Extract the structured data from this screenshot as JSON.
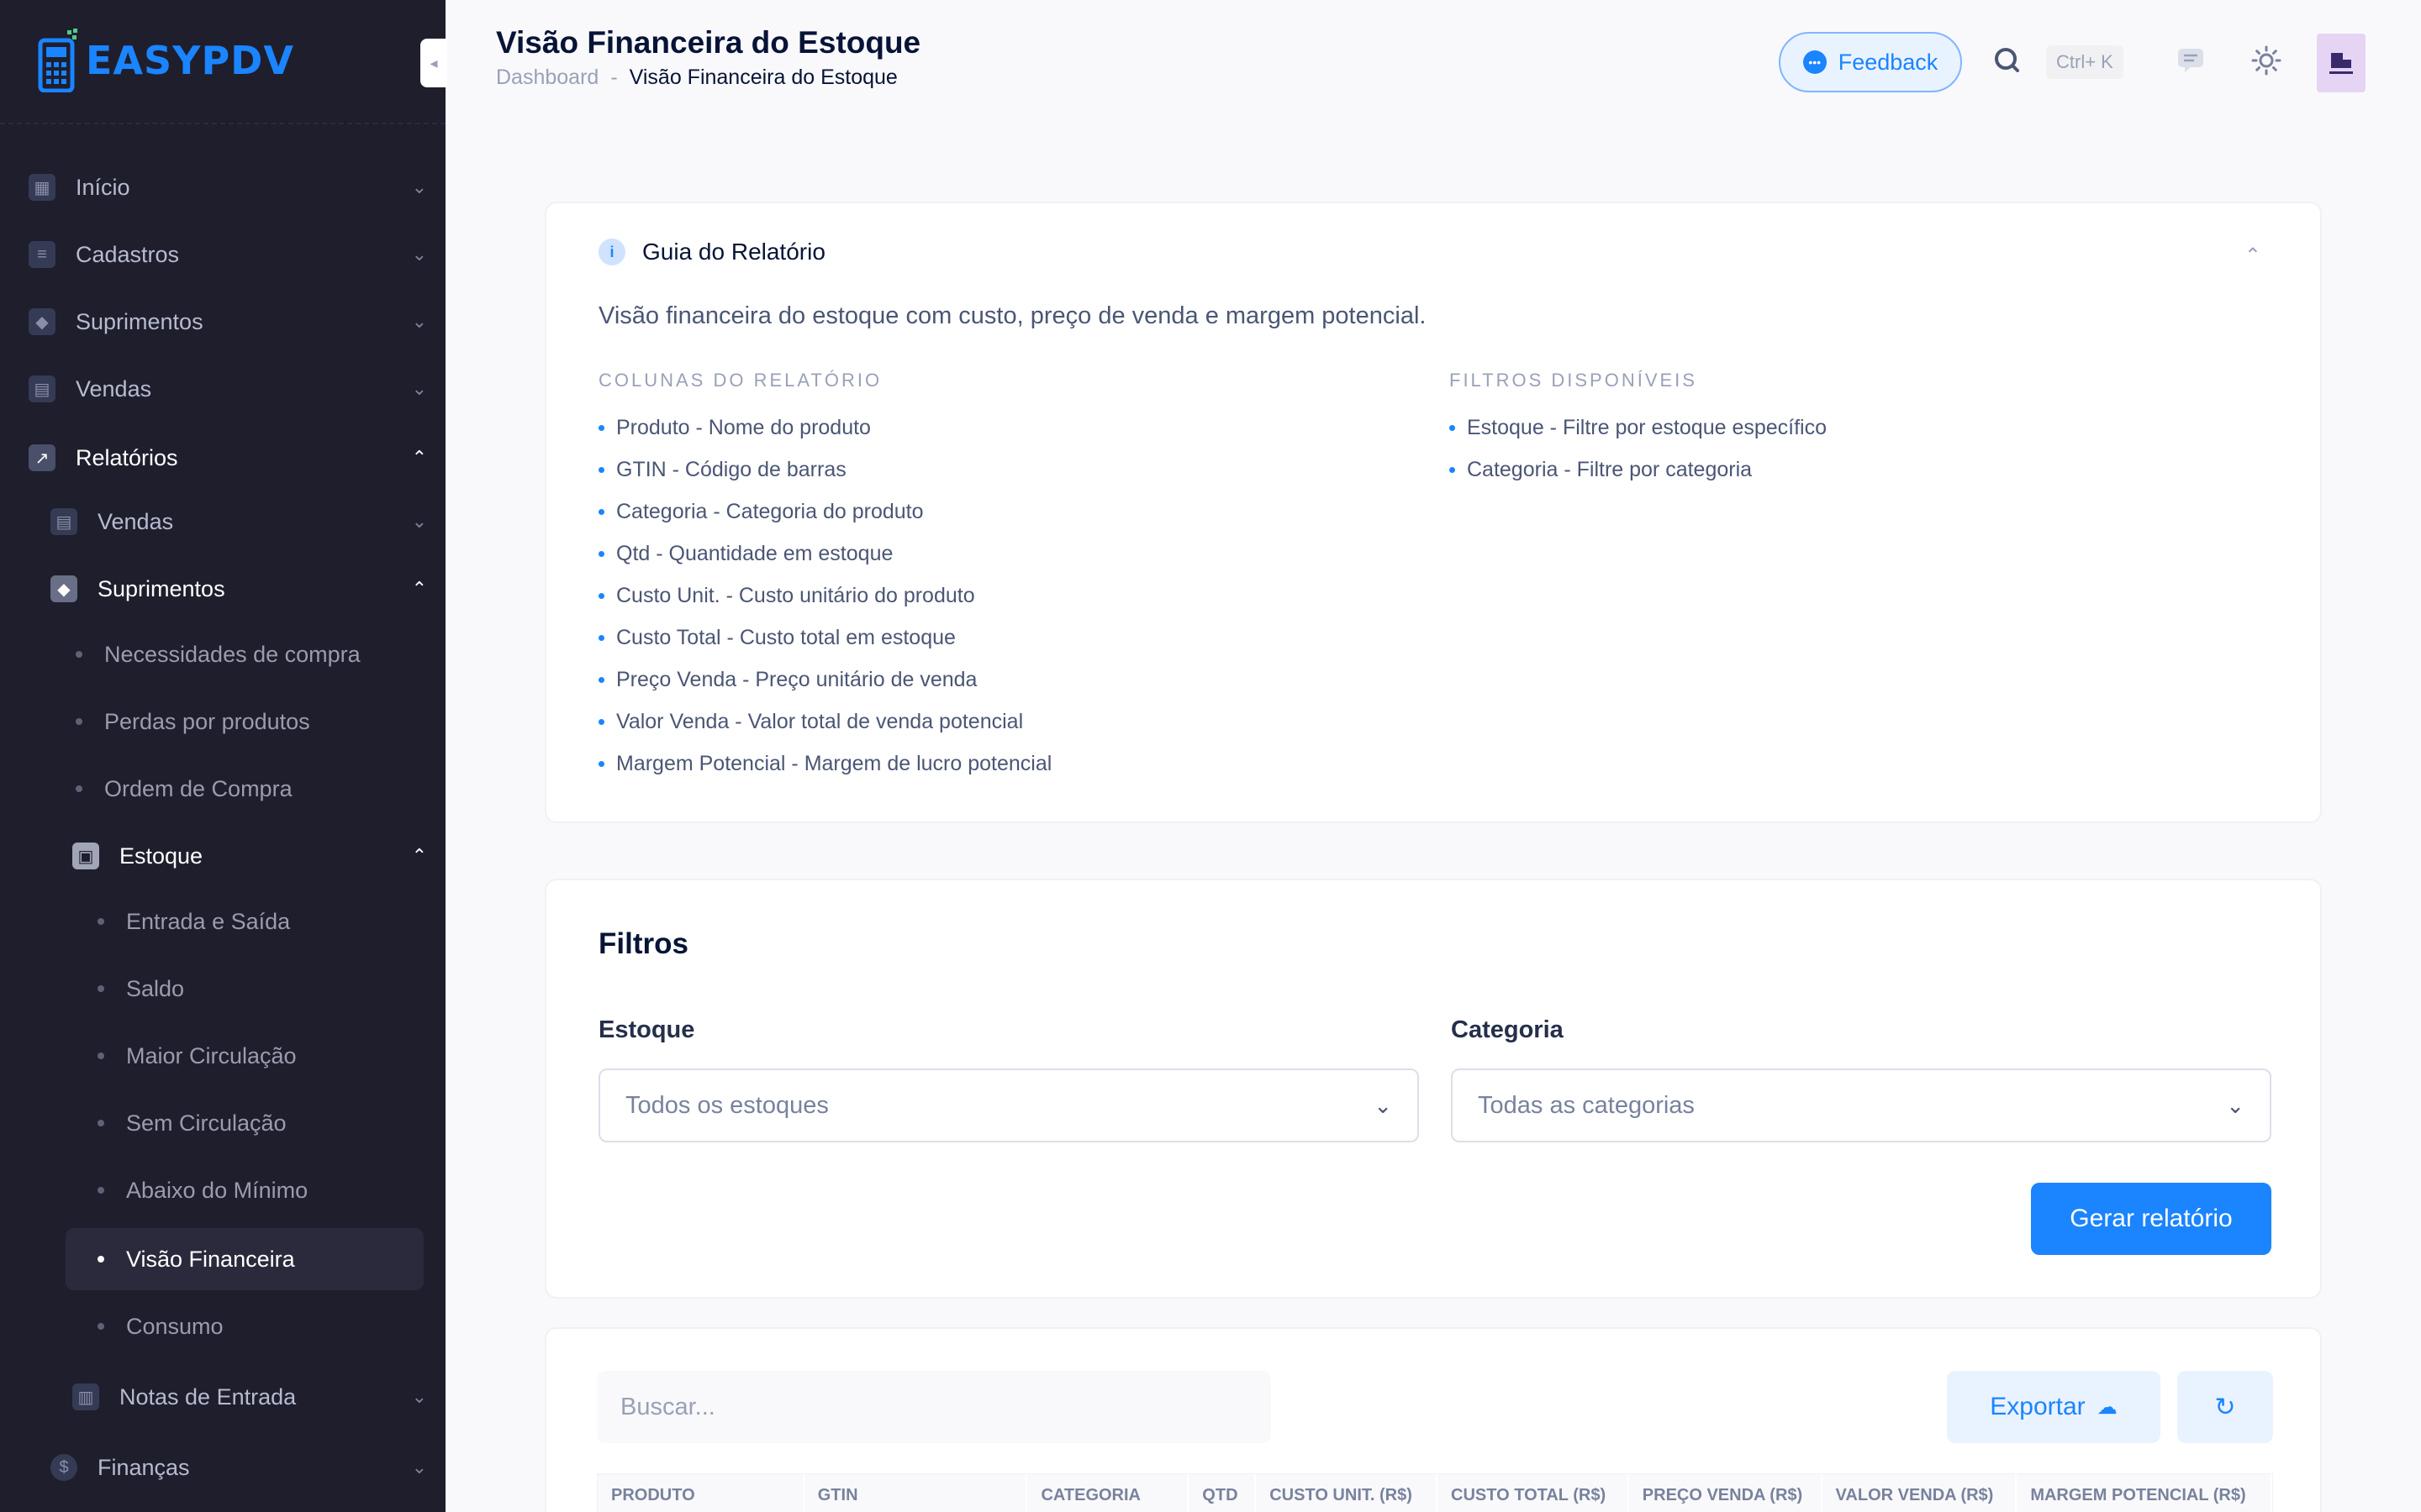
{
  "app": {
    "logo_easy": "EASY",
    "logo_pdv": "PDV"
  },
  "header": {
    "title": "Visão Financeira do Estoque",
    "breadcrumb_home": "Dashboard",
    "breadcrumb_sep": "-",
    "breadcrumb_current": "Visão Financeira do Estoque",
    "feedback_label": "Feedback",
    "search_shortcut": "Ctrl+ K"
  },
  "sidebar": {
    "items": [
      {
        "label": "Início"
      },
      {
        "label": "Cadastros"
      },
      {
        "label": "Suprimentos"
      },
      {
        "label": "Vendas"
      },
      {
        "label": "Relatórios"
      },
      {
        "label": "Vendas"
      },
      {
        "label": "Suprimentos"
      },
      {
        "label": "Necessidades de compra"
      },
      {
        "label": "Perdas por produtos"
      },
      {
        "label": "Ordem de Compra"
      },
      {
        "label": "Estoque"
      },
      {
        "label": "Entrada e Saída"
      },
      {
        "label": "Saldo"
      },
      {
        "label": "Maior Circulação"
      },
      {
        "label": "Sem Circulação"
      },
      {
        "label": "Abaixo do Mínimo"
      },
      {
        "label": "Visão Financeira"
      },
      {
        "label": "Consumo"
      },
      {
        "label": "Notas de Entrada"
      },
      {
        "label": "Finanças"
      }
    ]
  },
  "guide": {
    "title": "Guia do Relatório",
    "description": "Visão financeira do estoque com custo, preço de venda e margem potencial.",
    "columns_title": "COLUNAS DO RELATÓRIO",
    "columns": [
      "Produto - Nome do produto",
      "GTIN - Código de barras",
      "Categoria - Categoria do produto",
      "Qtd - Quantidade em estoque",
      "Custo Unit. - Custo unitário do produto",
      "Custo Total - Custo total em estoque",
      "Preço Venda - Preço unitário de venda",
      "Valor Venda - Valor total de venda potencial",
      "Margem Potencial - Margem de lucro potencial"
    ],
    "filters_title": "FILTROS DISPONÍVEIS",
    "filters": [
      "Estoque - Filtre por estoque específico",
      "Categoria - Filtre por categoria"
    ]
  },
  "filters": {
    "title": "Filtros",
    "estoque_label": "Estoque",
    "estoque_value": "Todos os estoques",
    "categoria_label": "Categoria",
    "categoria_value": "Todas as categorias",
    "generate_label": "Gerar relatório"
  },
  "table": {
    "search_placeholder": "Buscar...",
    "export_label": "Exportar",
    "columns": [
      "PRODUTO",
      "GTIN",
      "CATEGORIA",
      "QTD",
      "CUSTO UNIT. (R$)",
      "CUSTO TOTAL (R$)",
      "PREÇO VENDA (R$)",
      "VALOR VENDA (R$)",
      "MARGEM POTENCIAL (R$)"
    ]
  },
  "colors": {
    "accent": "#1b84ff",
    "sidebar_bg": "#1e1e2d",
    "page_bg": "#f9f9fb"
  }
}
